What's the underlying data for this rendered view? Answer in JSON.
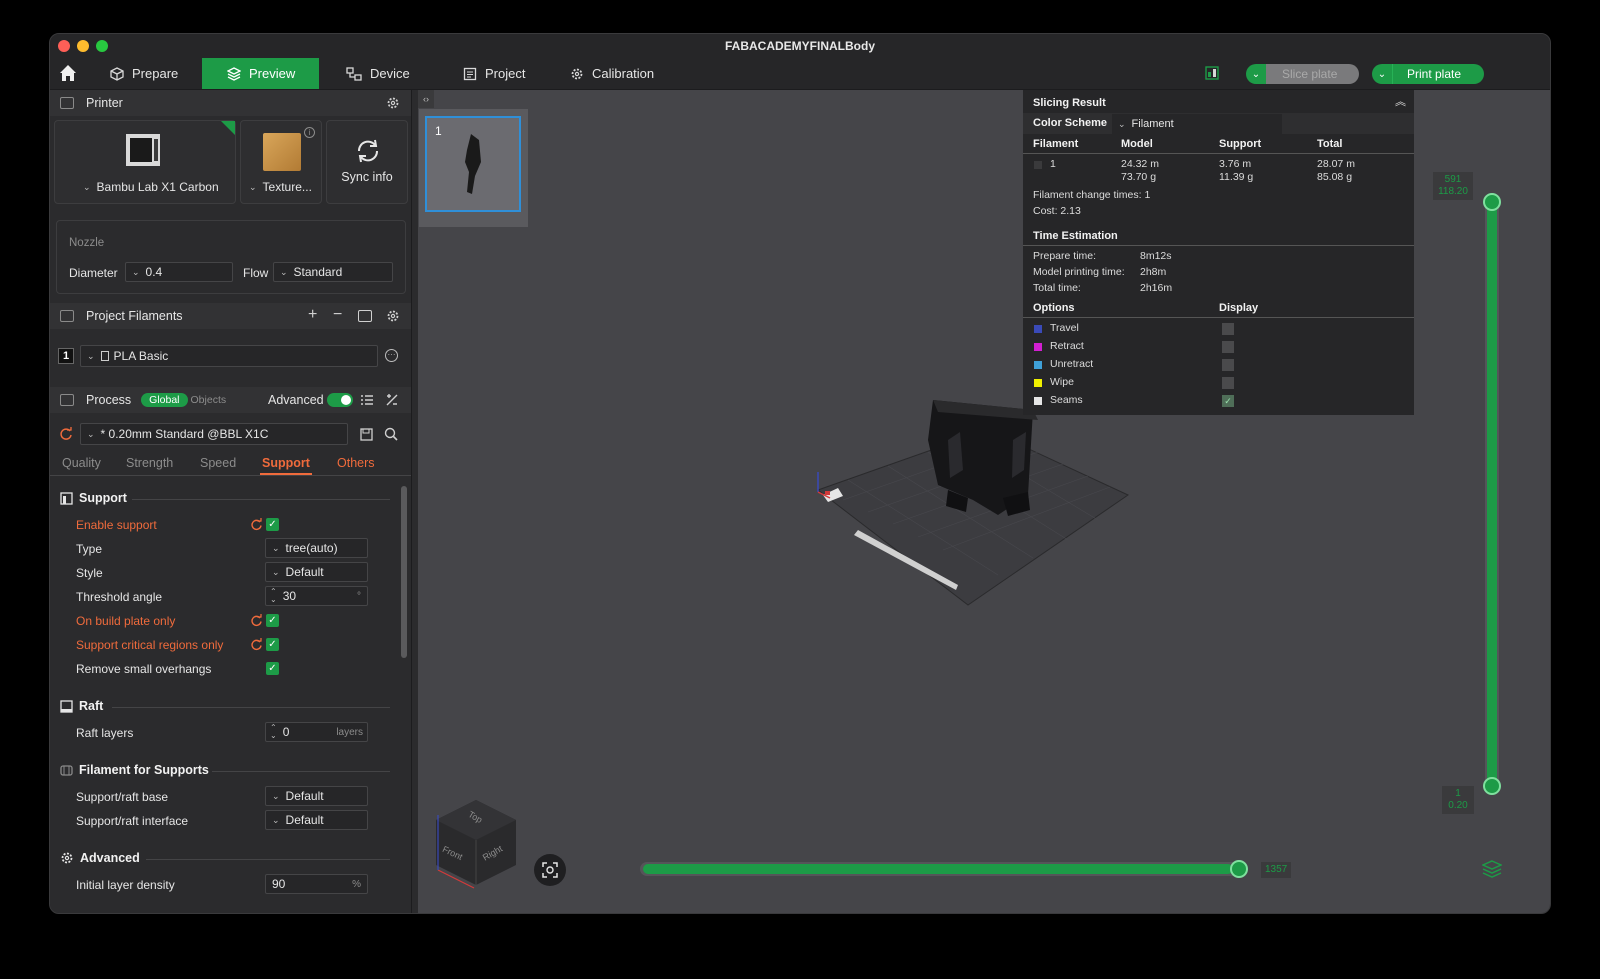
{
  "window": {
    "title": "FABACADEMYFINALBody"
  },
  "menubar": {
    "items": [
      {
        "label": "Prepare"
      },
      {
        "label": "Preview"
      },
      {
        "label": "Device"
      },
      {
        "label": "Project"
      },
      {
        "label": "Calibration"
      }
    ],
    "slice_label": "Slice plate",
    "print_label": "Print plate"
  },
  "printer": {
    "section_label": "Printer",
    "model": "Bambu Lab X1 Carbon",
    "plate": "Texture...",
    "sync_label": "Sync info",
    "nozzle_label": "Nozzle",
    "diameter_label": "Diameter",
    "diameter_value": "0.4",
    "flow_label": "Flow",
    "flow_value": "Standard"
  },
  "filaments": {
    "section_label": "Project Filaments",
    "items": [
      {
        "index": "1",
        "name": "PLA Basic"
      }
    ]
  },
  "process": {
    "section_label": "Process",
    "global_label": "Global",
    "objects_label": "Objects",
    "advanced_label": "Advanced",
    "preset": "* 0.20mm Standard @BBL X1C",
    "tabs": [
      "Quality",
      "Strength",
      "Speed",
      "Support",
      "Others"
    ]
  },
  "support": {
    "title": "Support",
    "enable": "Enable support",
    "type_label": "Type",
    "type_value": "tree(auto)",
    "style_label": "Style",
    "style_value": "Default",
    "threshold_label": "Threshold angle",
    "threshold_value": "30",
    "threshold_unit": "°",
    "build_plate_only": "On build plate only",
    "critical_regions": "Support critical regions only",
    "remove_small": "Remove small overhangs"
  },
  "raft": {
    "title": "Raft",
    "layers_label": "Raft layers",
    "layers_value": "0",
    "layers_unit": "layers"
  },
  "filament_supports": {
    "title": "Filament for Supports",
    "base_label": "Support/raft base",
    "base_value": "Default",
    "interface_label": "Support/raft interface",
    "interface_value": "Default"
  },
  "advanced": {
    "title": "Advanced",
    "density_label": "Initial layer density",
    "density_value": "90",
    "density_unit": "%"
  },
  "plate_thumb": {
    "number": "1"
  },
  "slicing_result": {
    "title": "Slicing Result",
    "color_scheme_label": "Color Scheme",
    "color_scheme_value": "Filament",
    "headers": [
      "Filament",
      "Model",
      "Support",
      "Total"
    ],
    "row": {
      "filament": "1",
      "model_len": "24.32 m",
      "model_wt": "73.70 g",
      "support_len": "3.76 m",
      "support_wt": "11.39 g",
      "total_len": "28.07 m",
      "total_wt": "85.08 g"
    },
    "change_times": "Filament change times:  1",
    "cost": "Cost:  2.13",
    "time_title": "Time Estimation",
    "prepare_label": "Prepare time:",
    "prepare_value": "8m12s",
    "model_time_label": "Model printing time:",
    "model_time_value": "2h8m",
    "total_label": "Total time:",
    "total_value": "2h16m",
    "options_label": "Options",
    "display_label": "Display",
    "options": [
      {
        "name": "Travel",
        "color": "#3a4ab8"
      },
      {
        "name": "Retract",
        "color": "#d21fd2"
      },
      {
        "name": "Unretract",
        "color": "#3fa0d8"
      },
      {
        "name": "Wipe",
        "color": "#f0f000"
      },
      {
        "name": "Seams",
        "color": "#e6e6e6"
      }
    ]
  },
  "layer_slider": {
    "top_layer": "591",
    "top_height": "118.20",
    "bottom_layer": "1",
    "bottom_height": "0.20"
  },
  "move_slider": {
    "value": "1357"
  },
  "view_cube": {
    "top": "Top",
    "front": "Front",
    "right": "Right"
  }
}
